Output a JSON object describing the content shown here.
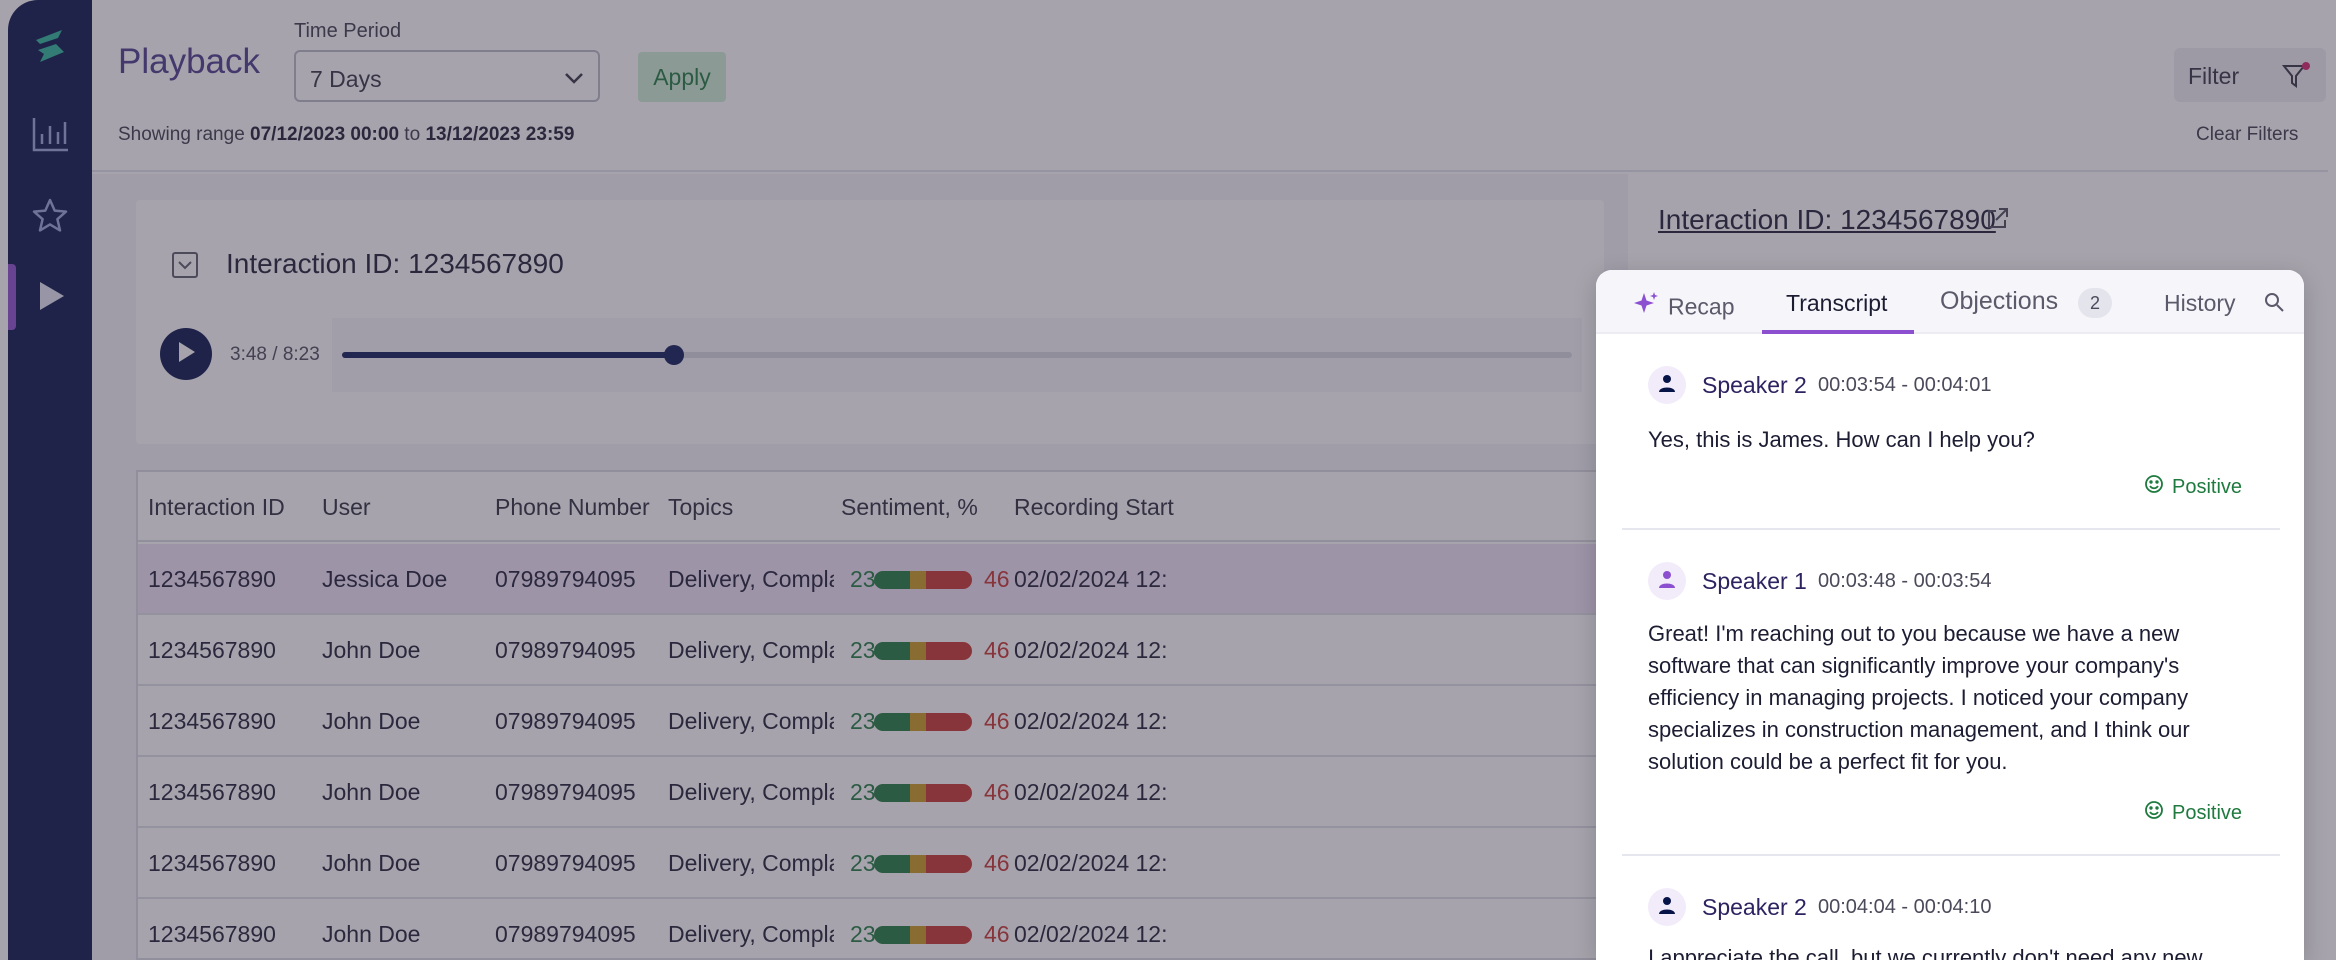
{
  "sidebar": {
    "items": [
      {
        "name": "analytics",
        "icon": "bar-chart-icon"
      },
      {
        "name": "favorites",
        "icon": "star-icon"
      },
      {
        "name": "playback",
        "icon": "play-icon",
        "active": true
      }
    ]
  },
  "header": {
    "title": "Playback",
    "time_period_label": "Time Period",
    "time_period_value": "7 Days",
    "apply_label": "Apply",
    "range_prefix": "Showing range",
    "range_start": "07/12/2023 00:00",
    "range_to": "to",
    "range_end": "13/12/2023 23:59",
    "filter_label": "Filter",
    "clear_filters_label": "Clear Filters"
  },
  "player": {
    "title": "Interaction ID: 1234567890",
    "time": "3:48 / 8:23",
    "progress": 0.27
  },
  "table": {
    "columns": [
      "Interaction ID",
      "User",
      "Phone Number",
      "Topics",
      "Sentiment, %",
      "Recording Start"
    ],
    "rows": [
      {
        "id": "1234567890",
        "user": "Jessica Doe",
        "phone": "07989794095",
        "topics": "Delivery, Complaint...",
        "sent_low": "23",
        "sent_high": "46",
        "start": "02/02/2024 12:"
      },
      {
        "id": "1234567890",
        "user": "John Doe",
        "phone": "07989794095",
        "topics": "Delivery, Complaint...",
        "sent_low": "23",
        "sent_high": "46",
        "start": "02/02/2024 12:"
      },
      {
        "id": "1234567890",
        "user": "John Doe",
        "phone": "07989794095",
        "topics": "Delivery, Complaint...",
        "sent_low": "23",
        "sent_high": "46",
        "start": "02/02/2024 12:"
      },
      {
        "id": "1234567890",
        "user": "John Doe",
        "phone": "07989794095",
        "topics": "Delivery, Complaint...",
        "sent_low": "23",
        "sent_high": "46",
        "start": "02/02/2024 12:"
      },
      {
        "id": "1234567890",
        "user": "John Doe",
        "phone": "07989794095",
        "topics": "Delivery, Complaint...",
        "sent_low": "23",
        "sent_high": "46",
        "start": "02/02/2024 12:"
      },
      {
        "id": "1234567890",
        "user": "John Doe",
        "phone": "07989794095",
        "topics": "Delivery, Complaint...",
        "sent_low": "23",
        "sent_high": "46",
        "start": "02/02/2024 12:"
      }
    ]
  },
  "right_panel": {
    "link": "Interaction ID: 1234567890"
  },
  "transcript": {
    "tabs": {
      "recap": "Recap",
      "transcript": "Transcript",
      "objections": "Objections",
      "objections_count": "2",
      "history": "History"
    },
    "messages": [
      {
        "speaker": "Speaker 2",
        "time": "00:03:54 - 00:04:01",
        "text": "Yes, this is James. How can I help you?",
        "sentiment": "Positive"
      },
      {
        "speaker": "Speaker 1",
        "time": "00:03:48 - 00:03:54",
        "text": "Great! I'm reaching out to you because we have a new software that can significantly improve your company's efficiency in managing projects. I noticed your company specializes in construction management, and I think our solution could be a perfect fit for you.",
        "sentiment": "Positive"
      },
      {
        "speaker": "Speaker 2",
        "time": "00:04:04 - 00:04:10",
        "text": "I appreciate the call, but we currently don't need any new",
        "sentiment": ""
      }
    ]
  },
  "colors": {
    "sidebar_bg": "#071448",
    "accent_purple": "#8b4fd0",
    "positive_green": "#1f7a3f",
    "negative_red": "#c6322f"
  }
}
